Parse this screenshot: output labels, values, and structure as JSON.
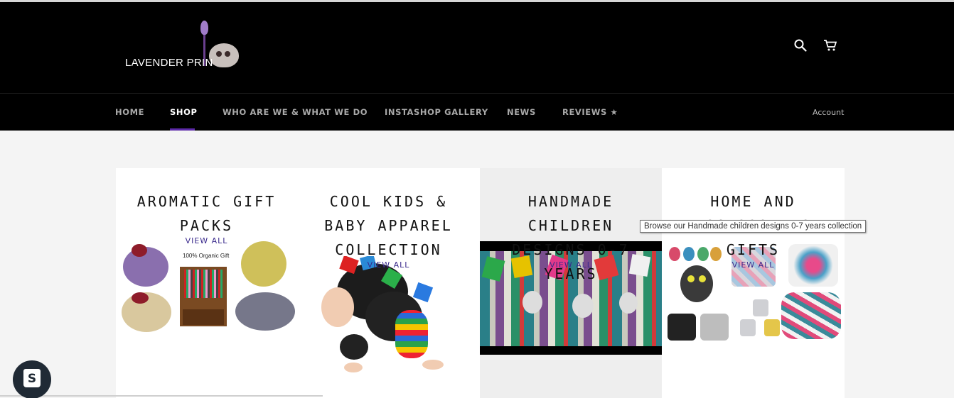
{
  "header": {
    "logo_text": "LAVENDER PRIN",
    "icons": [
      "search-icon",
      "cart-icon"
    ]
  },
  "nav": {
    "items": [
      {
        "label": "HOME"
      },
      {
        "label": "SHOP"
      },
      {
        "label": "WHO ARE WE & WHAT WE DO"
      },
      {
        "label": "INSTASHOP GALLERY"
      },
      {
        "label": "NEWS"
      },
      {
        "label": "REVIEWS ★"
      }
    ],
    "active": "SHOP",
    "account_label": "Account",
    "accent_color": "#5c2aa8"
  },
  "collections": [
    {
      "title": "AROMATIC GIFT PACKS",
      "view_all": "VIEW ALL",
      "image_caption": "100% Organic Gift"
    },
    {
      "title": "COOL KIDS & BABY APPAREL COLLECTION",
      "view_all": "VIEW ALL"
    },
    {
      "title": "HANDMADE CHILDREN DESIGNS 0-7 YEARS",
      "view_all": "VIEW ALL"
    },
    {
      "title": "HOME AND ACCESSORIES GIFTS",
      "view_all": "VIEW ALL"
    }
  ],
  "tooltip": "Browse our Handmade children designs 0-7 years collection"
}
